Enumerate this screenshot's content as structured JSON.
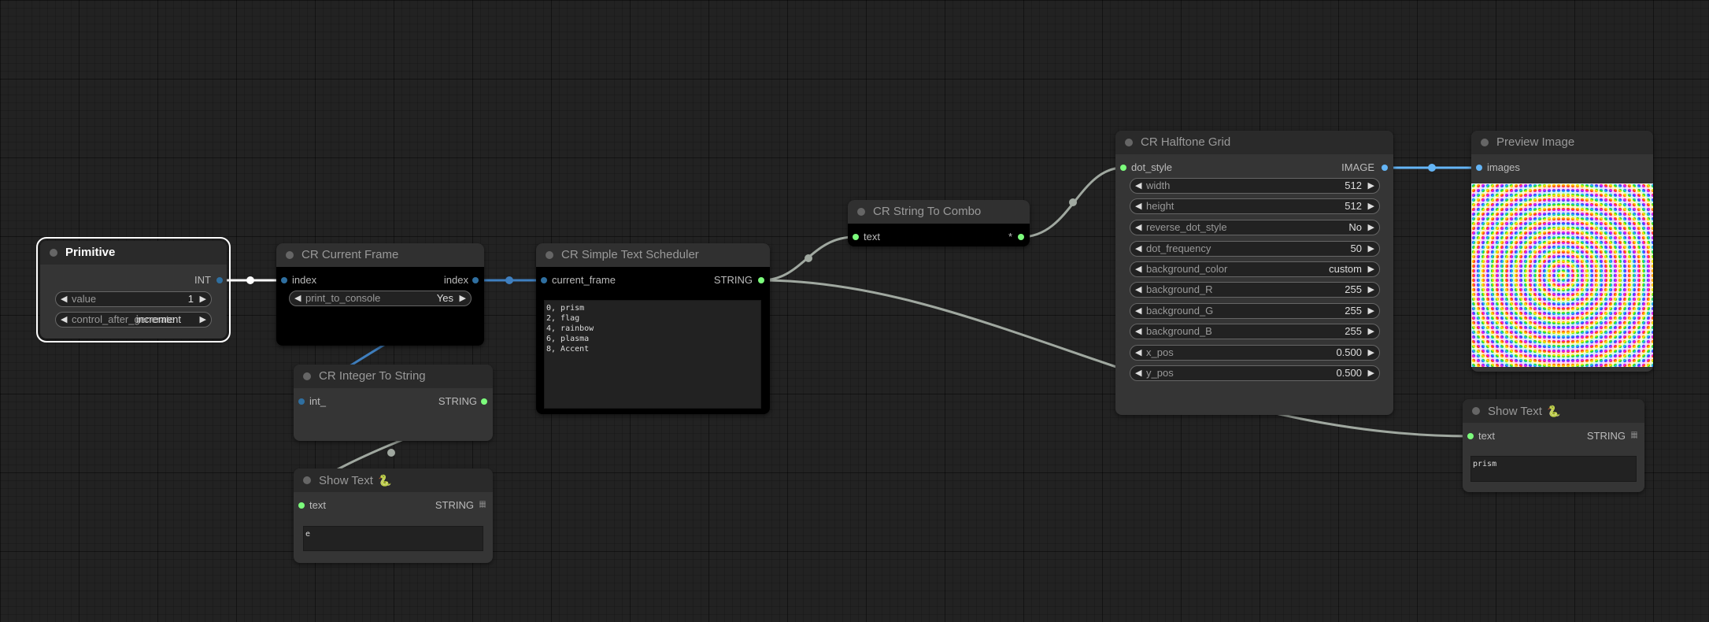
{
  "nodes": {
    "primitive": {
      "title": "Primitive",
      "output": "INT",
      "widgets": [
        {
          "name": "value",
          "value": "1"
        },
        {
          "name": "control_after_generate",
          "value": "increment"
        }
      ]
    },
    "current_frame": {
      "title": "CR Current Frame",
      "input": "index",
      "output": "index",
      "widgets": [
        {
          "name": "print_to_console",
          "value": "Yes"
        }
      ]
    },
    "integer_to_string": {
      "title": "CR Integer To String",
      "input": "int_",
      "output": "STRING"
    },
    "show_text_1": {
      "title": "Show Text",
      "badge": "🐍",
      "input": "text",
      "output": "STRING",
      "text": "e"
    },
    "text_scheduler": {
      "title": "CR Simple Text Scheduler",
      "input": "current_frame",
      "output": "STRING",
      "schedule": "0, prism\n2, flag\n4, rainbow\n6, plasma\n8, Accent"
    },
    "string_to_combo": {
      "title": "CR String To Combo",
      "input": "text",
      "output": "*"
    },
    "halftone_grid": {
      "title": "CR Halftone Grid",
      "input": "dot_style",
      "output": "IMAGE",
      "widgets": [
        {
          "name": "width",
          "value": "512"
        },
        {
          "name": "height",
          "value": "512"
        },
        {
          "name": "reverse_dot_style",
          "value": "No"
        },
        {
          "name": "dot_frequency",
          "value": "50"
        },
        {
          "name": "background_color",
          "value": "custom"
        },
        {
          "name": "background_R",
          "value": "255"
        },
        {
          "name": "background_G",
          "value": "255"
        },
        {
          "name": "background_B",
          "value": "255"
        },
        {
          "name": "x_pos",
          "value": "0.500"
        },
        {
          "name": "y_pos",
          "value": "0.500"
        }
      ]
    },
    "preview_image": {
      "title": "Preview Image",
      "input": "images"
    },
    "show_text_2": {
      "title": "Show Text",
      "badge": "🐍",
      "input": "text",
      "output": "STRING",
      "text": "prism"
    }
  },
  "icons": {
    "arrow_left": "◀",
    "arrow_right": "▶",
    "grid": "𝄜"
  },
  "colors": {
    "background": "#222222",
    "node": "#353535",
    "int_link": "#3f7fbf",
    "string_link": "#a0a8a0",
    "image_link": "#64b5f6",
    "string_slot": "#7cfc7c",
    "int_slot": "#2f6fa0"
  }
}
